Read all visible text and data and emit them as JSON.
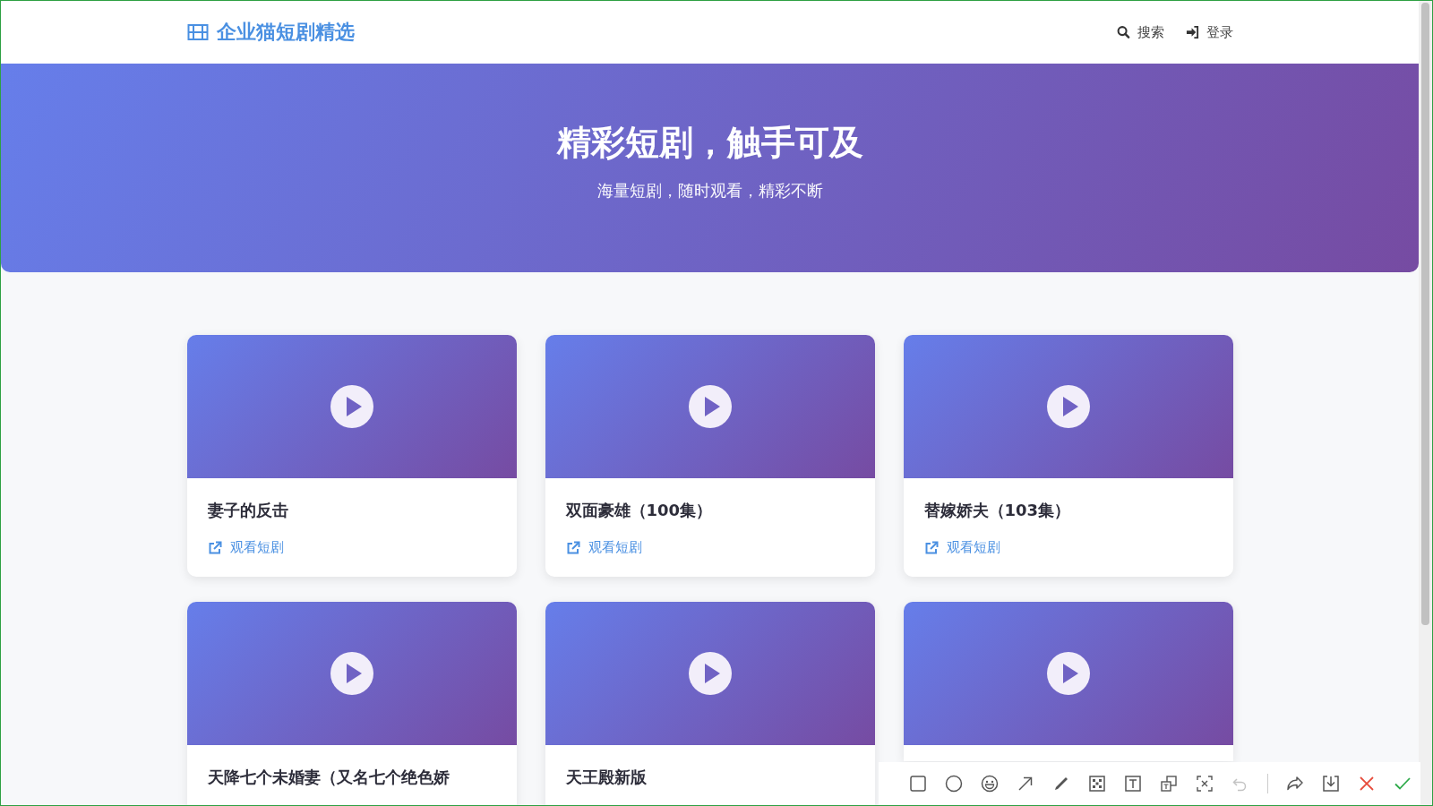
{
  "header": {
    "logo": "企业猫短剧精选",
    "nav": [
      {
        "kind": "search",
        "label": "搜索"
      },
      {
        "kind": "login",
        "label": "登录"
      }
    ]
  },
  "hero": {
    "title": "精彩短剧，触手可及",
    "subtitle": "海量短剧，随时观看，精彩不断"
  },
  "dramas": [
    {
      "title": "妻子的反击",
      "link": "观看短剧"
    },
    {
      "title": "双面豪雄（100集）",
      "link": "观看短剧"
    },
    {
      "title": "替嫁娇夫（103集）",
      "link": "观看短剧"
    },
    {
      "title": "天降七个未婚妻（又名七个绝色娇"
    },
    {
      "title": "天王殿新版"
    },
    {
      "kind": "covered"
    }
  ],
  "toolbar": {
    "tools": [
      {
        "kind": "rect",
        "disabled": false
      },
      {
        "kind": "ellipse",
        "disabled": false
      },
      {
        "kind": "emoji",
        "disabled": false
      },
      {
        "kind": "arrow",
        "disabled": false
      },
      {
        "kind": "pen",
        "disabled": false
      },
      {
        "kind": "mosaic",
        "disabled": false
      },
      {
        "kind": "text",
        "disabled": false
      },
      {
        "kind": "translate",
        "disabled": false
      },
      {
        "kind": "ocr",
        "disabled": false
      },
      {
        "kind": "undo",
        "disabled": true
      },
      {
        "kind": "sep"
      },
      {
        "kind": "share",
        "disabled": false
      },
      {
        "kind": "save",
        "disabled": false
      },
      {
        "kind": "cancel",
        "disabled": false
      },
      {
        "kind": "done",
        "disabled": false
      }
    ]
  }
}
